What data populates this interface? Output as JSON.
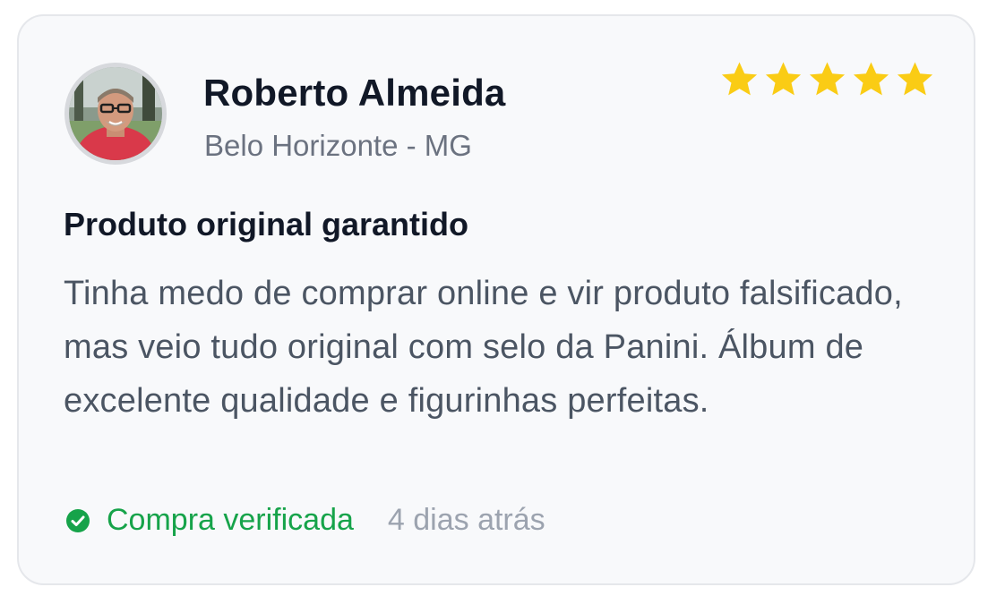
{
  "review": {
    "author_name": "Roberto Almeida",
    "author_location": "Belo Horizonte - MG",
    "rating": 5,
    "rating_max": 5,
    "title": "Produto original garantido",
    "body": "Tinha medo de comprar online e vir produto falsificado, mas veio tudo original com selo da Panini. Álbum de excelente qualidade e figurinhas perfeitas.",
    "verified_label": "Compra verificada",
    "time_ago": "4 dias atrás"
  },
  "icons": {
    "star": "star-icon",
    "verified": "check-circle-icon",
    "avatar": "avatar"
  },
  "colors": {
    "star": "#facc15",
    "verified": "#16a34a",
    "card_background": "#f8f9fb",
    "card_border": "#e5e7eb",
    "title_text": "#111827",
    "body_text": "#4b5563",
    "muted_text": "#9ca3af"
  }
}
